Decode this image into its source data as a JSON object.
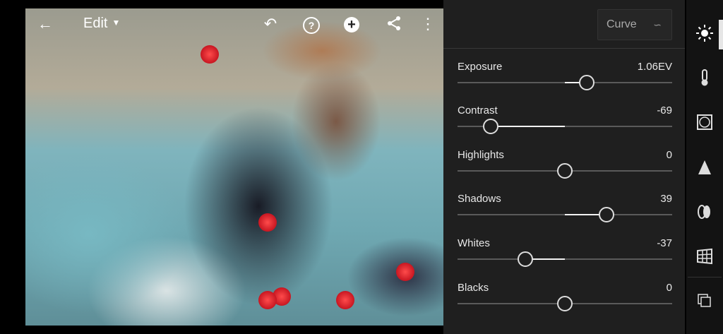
{
  "topbar": {
    "title": "Edit",
    "icons": [
      "back-arrow-icon",
      "undo-icon",
      "help-icon",
      "add-icon",
      "share-icon",
      "more-vertical-icon"
    ]
  },
  "curve_button": {
    "label": "Curve"
  },
  "adjustments": [
    {
      "label": "Exposure",
      "value": "1.06EV",
      "fraction": 0.603
    },
    {
      "label": "Contrast",
      "value": "-69",
      "fraction": 0.155
    },
    {
      "label": "Highlights",
      "value": "0",
      "fraction": 0.5
    },
    {
      "label": "Shadows",
      "value": "39",
      "fraction": 0.695
    },
    {
      "label": "Whites",
      "value": "-37",
      "fraction": 0.315
    },
    {
      "label": "Blacks",
      "value": "0",
      "fraction": 0.5
    }
  ],
  "rail": [
    "light-icon",
    "color-icon",
    "effects-icon",
    "detail-icon",
    "optics-icon",
    "geometry-icon",
    "presets-icon"
  ]
}
